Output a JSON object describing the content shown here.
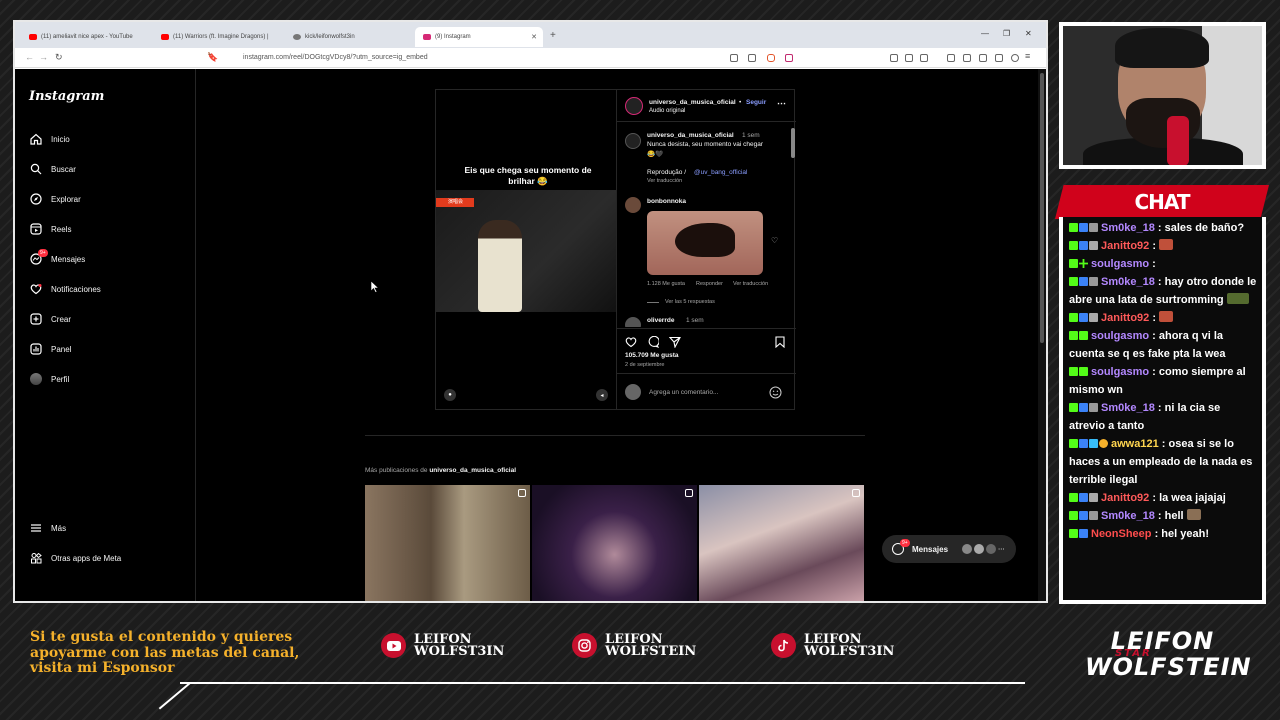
{
  "browser": {
    "tabs": [
      {
        "label": "(11) ameliavit nice apex - YouTube",
        "color": "#ff0000"
      },
      {
        "label": "(11) Warriors (ft. Imagine Dragons) |",
        "color": "#ff0000"
      },
      {
        "label": "kick/leifonwolfst3in",
        "color": "#777777"
      },
      {
        "label": "(9) Instagram",
        "color": "#d62976"
      }
    ],
    "url": "instagram.com/reel/DOGtcgVDcy8/?utm_source=ig_embed"
  },
  "instagram": {
    "logo": "Instagram",
    "nav": [
      {
        "label": "Inicio",
        "icon": "home-icon"
      },
      {
        "label": "Buscar",
        "icon": "search-icon"
      },
      {
        "label": "Explorar",
        "icon": "compass-icon"
      },
      {
        "label": "Reels",
        "icon": "reels-icon"
      },
      {
        "label": "Mensajes",
        "icon": "messenger-icon",
        "badge": "9+"
      },
      {
        "label": "Notificaciones",
        "icon": "heart-icon"
      },
      {
        "label": "Crear",
        "icon": "plus-square-icon"
      },
      {
        "label": "Panel",
        "icon": "chart-icon"
      },
      {
        "label": "Perfil",
        "icon": "profile-avatar"
      }
    ],
    "more": "Más",
    "meta_apps": "Otras apps de Meta",
    "post": {
      "overlay": "Eis que chega seu momento de brilhar 😂",
      "video_tag": "演唱会",
      "author": "universo_da_musica_oficial",
      "follow_sep": "•",
      "follow": "Seguir",
      "audio": "Audio original",
      "caption_author": "universo_da_musica_oficial",
      "caption_time": "1 sem",
      "caption": "Nunca desista, seu momento vai chegar",
      "caption_emoji": "😂🖤",
      "repro": "Reprodução /",
      "repro_handle": "@uv_bang_official",
      "see_translation": "Ver traducción",
      "comment_author": "bonbonnoka",
      "comment_likes": "1.128 Me gusta",
      "reply": "Responder",
      "comment_translation": "Ver traducción",
      "view_replies": "Ver las 5 respuestas",
      "next_author": "oliverrde",
      "next_time": "1 sem",
      "likes": "105.709 Me gusta",
      "date": "2 de septiembre",
      "add_comment_placeholder": "Agrega un comentario..."
    },
    "more_posts_prefix": "Más publicaciones de",
    "more_posts_author": "universo_da_musica_oficial",
    "messages_pill": "Mensajes",
    "messages_badge": "9+"
  },
  "chat": {
    "title": "CHAT",
    "messages": [
      {
        "user": "Sm0ke_18",
        "color": "#b388ff",
        "text": ": sales de baño?",
        "emote": false
      },
      {
        "user": "Janitto92",
        "color": "#ff5a5a",
        "text": ":",
        "emote": true
      },
      {
        "user": "soulgasmo",
        "color": "#b388ff",
        "text": ":",
        "emote": false
      },
      {
        "user": "Sm0ke_18",
        "color": "#b388ff",
        "text": ": hay otro donde le abre una lata de surtromming",
        "emote": true
      },
      {
        "user": "Janitto92",
        "color": "#ff5a5a",
        "text": ":",
        "emote": true
      },
      {
        "user": "soulgasmo",
        "color": "#b388ff",
        "text": ": ahora q vi la cuenta se q es fake pta la wea",
        "emote": false
      },
      {
        "user": "soulgasmo",
        "color": "#b388ff",
        "text": ": como siempre al mismo wn",
        "emote": false
      },
      {
        "user": "Sm0ke_18",
        "color": "#b388ff",
        "text": ": ni la cia se atrevio a tanto",
        "emote": false
      },
      {
        "user": "awwa121",
        "color": "#ffd54f",
        "text": ": osea si se lo haces a un empleado de la nada es terrible ilegal",
        "emote": false
      },
      {
        "user": "Janitto92",
        "color": "#ff5a5a",
        "text": ": la wea",
        "emote": false,
        "after": "jajajaj"
      },
      {
        "user": "Sm0ke_18",
        "color": "#b388ff",
        "text": ": hell",
        "emote": true
      },
      {
        "user": "NeonSheep",
        "color": "#ff4d4d",
        "text": ": hel yeah!",
        "emote": false
      }
    ]
  },
  "overlay": {
    "sponsor": [
      "Si te gusta el contenido y quieres",
      "apoyarme con las metas del canal,",
      "visita mi Esponsor"
    ],
    "socials": [
      {
        "icon": "youtube-icon",
        "line1": "LEIFON",
        "line2": "WOLFST3IN"
      },
      {
        "icon": "instagram-icon",
        "line1": "LEIFON",
        "line2": "WOLFSTEIN"
      },
      {
        "icon": "tiktok-icon",
        "line1": "LEIFON",
        "line2": "WOLFST3IN"
      }
    ],
    "brand_line1": "LEIFON",
    "brand_line2": "WOLFSTEIN",
    "brand_mid": "STAR"
  },
  "colors": {
    "accent_red": "#c8102e",
    "gold": "#f5b12b",
    "instagram_blue": "#8a9dff"
  }
}
